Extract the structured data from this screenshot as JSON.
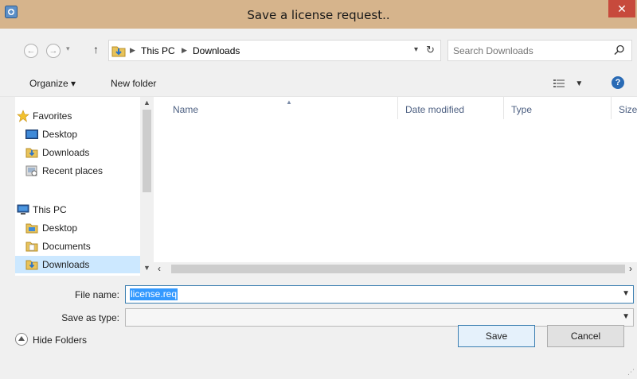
{
  "window": {
    "title": "Save a license request..",
    "close_glyph": "✕"
  },
  "address": {
    "crumbs": [
      "This PC",
      "Downloads"
    ],
    "search_placeholder": "Search Downloads"
  },
  "toolbar": {
    "organize_label": "Organize ▾",
    "new_folder_label": "New folder",
    "help_glyph": "?"
  },
  "nav": {
    "favorites_label": "Favorites",
    "favorites_items": [
      "Desktop",
      "Downloads",
      "Recent places"
    ],
    "thispc_label": "This PC",
    "thispc_items": [
      "Desktop",
      "Documents",
      "Downloads"
    ],
    "selected": "Downloads"
  },
  "columns": [
    "Name",
    "Date modified",
    "Type",
    "Size"
  ],
  "form": {
    "filename_label": "File name:",
    "filename_value": "license.req",
    "savetype_label": "Save as type:",
    "savetype_value": ""
  },
  "footer": {
    "hide_folders_label": "Hide Folders",
    "save_label": "Save",
    "cancel_label": "Cancel"
  },
  "colors": {
    "titlebar": "#d6b48c",
    "close": "#c74a3c",
    "selection": "#3399ff",
    "nav_selected": "#cce8ff"
  }
}
